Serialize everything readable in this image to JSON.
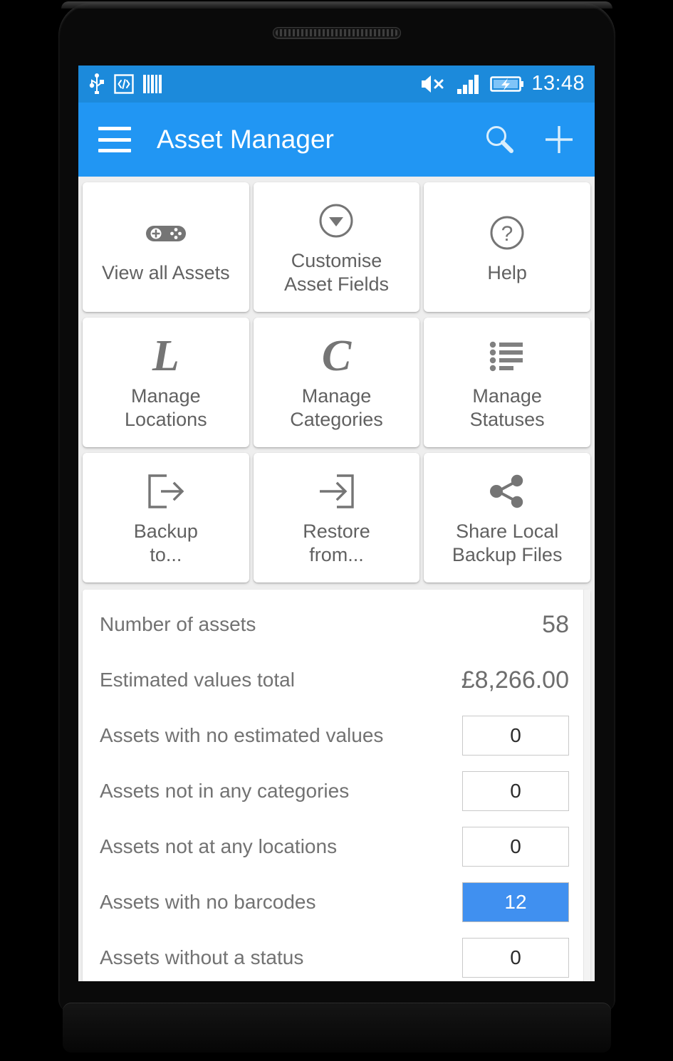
{
  "status_bar": {
    "icons": [
      "usb-icon",
      "developer-code-icon",
      "barcode-icon",
      "volume-muted-icon",
      "signal-bars-icon",
      "battery-charging-icon"
    ],
    "clock": "13:48"
  },
  "action_bar": {
    "menu_icon": "hamburger-menu-icon",
    "title": "Asset Manager",
    "search_icon": "search-icon",
    "add_icon": "plus-icon"
  },
  "tiles": [
    {
      "label": "View all Assets",
      "icon": "gamepad-icon"
    },
    {
      "label": "Customise\nAsset Fields",
      "icon": "circle-down-arrow-icon"
    },
    {
      "label": "Help",
      "icon": "question-mark-circle-icon"
    },
    {
      "label": "Manage\nLocations",
      "icon": "letter-l-icon",
      "glyph": "L"
    },
    {
      "label": "Manage\nCategories",
      "icon": "letter-c-icon",
      "glyph": "C"
    },
    {
      "label": "Manage\nStatuses",
      "icon": "bulleted-list-icon"
    },
    {
      "label": "Backup\nto...",
      "icon": "export-arrow-icon"
    },
    {
      "label": "Restore\nfrom...",
      "icon": "import-arrow-icon"
    },
    {
      "label": "Share Local\nBackup Files",
      "icon": "share-icon"
    }
  ],
  "stats": [
    {
      "label": "Number of assets",
      "value": "58",
      "style": "plain"
    },
    {
      "label": "Estimated values total",
      "value": "£8,266.00",
      "style": "plain"
    },
    {
      "label": "Assets with no estimated values",
      "value": "0",
      "style": "badge"
    },
    {
      "label": "Assets not in any categories",
      "value": "0",
      "style": "badge"
    },
    {
      "label": "Assets not at any locations",
      "value": "0",
      "style": "badge"
    },
    {
      "label": "Assets with no barcodes",
      "value": "12",
      "style": "badge-highlight"
    },
    {
      "label": "Assets without a status",
      "value": "0",
      "style": "badge"
    }
  ],
  "colors": {
    "status_bar": "#1c8adb",
    "action_bar": "#2196f3",
    "accent_badge": "#4090f0",
    "screen_background": "#eeeeee",
    "tile_text": "#616161",
    "stat_label": "#727272"
  }
}
